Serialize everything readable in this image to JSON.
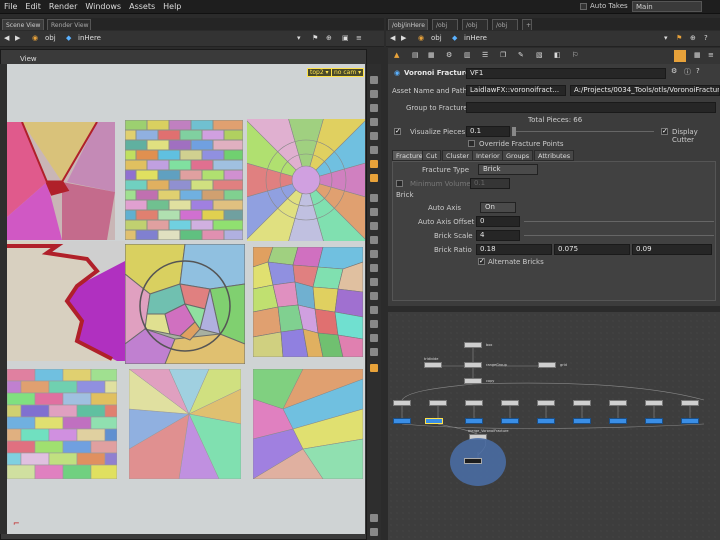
{
  "menubar": {
    "items": [
      "File",
      "Edit",
      "Render",
      "Windows",
      "Assets",
      "Help"
    ],
    "auto_takes": "Auto Takes",
    "desktop": "Main"
  },
  "left": {
    "tabs": [
      "Scene View",
      "Render View"
    ],
    "path": [
      "obj",
      "inHere"
    ],
    "view_title": "View",
    "view_menus": [
      "top2 ▾",
      "no cam ▾"
    ]
  },
  "right": {
    "tabs": [
      "/obj/inHere",
      "/obj",
      "/obj",
      "/obj"
    ],
    "path": [
      "obj",
      "inHere"
    ]
  },
  "params": {
    "node_type": "Voronoi Fracture",
    "node_name": "VF1",
    "asset_label": "Asset Name and Path",
    "asset_value": "LaidlawFX::voronoifract...",
    "asset_path": "A:/Projects/0034_Tools/otls/VoronoiFractur...",
    "group_label": "Group to Fracture",
    "total_pieces": "Total Pieces: 66",
    "visualize_label": "Visualize Pieces",
    "visualize_value": "0.1",
    "display_cutter": "Display Cutter",
    "override_label": "Override Fracture Points",
    "tabs": [
      "Fracture",
      "Cut",
      "Cluster",
      "Interior",
      "Groups",
      "Attributes"
    ],
    "fracture_type_label": "Fracture Type",
    "fracture_type_value": "Brick",
    "min_volume_label": "Minimum Volume",
    "min_volume_value": "0.1",
    "brick_section": "Brick",
    "auto_axis_label": "Auto Axis",
    "auto_axis_value": "On",
    "auto_axis_offset_label": "Auto Axis Offset",
    "auto_axis_offset_value": "0",
    "brick_scale_label": "Brick Scale",
    "brick_scale_value": "4",
    "brick_ratio_label": "Brick Ratio",
    "brick_ratio_values": [
      "0.18",
      "0.075",
      "0.09"
    ],
    "alternate_bricks": "Alternate Bricks"
  },
  "colors": {
    "accent": "#e8a23a",
    "node_blue": "#3a8ee6",
    "viewport_bg": "#cfd3d4"
  }
}
